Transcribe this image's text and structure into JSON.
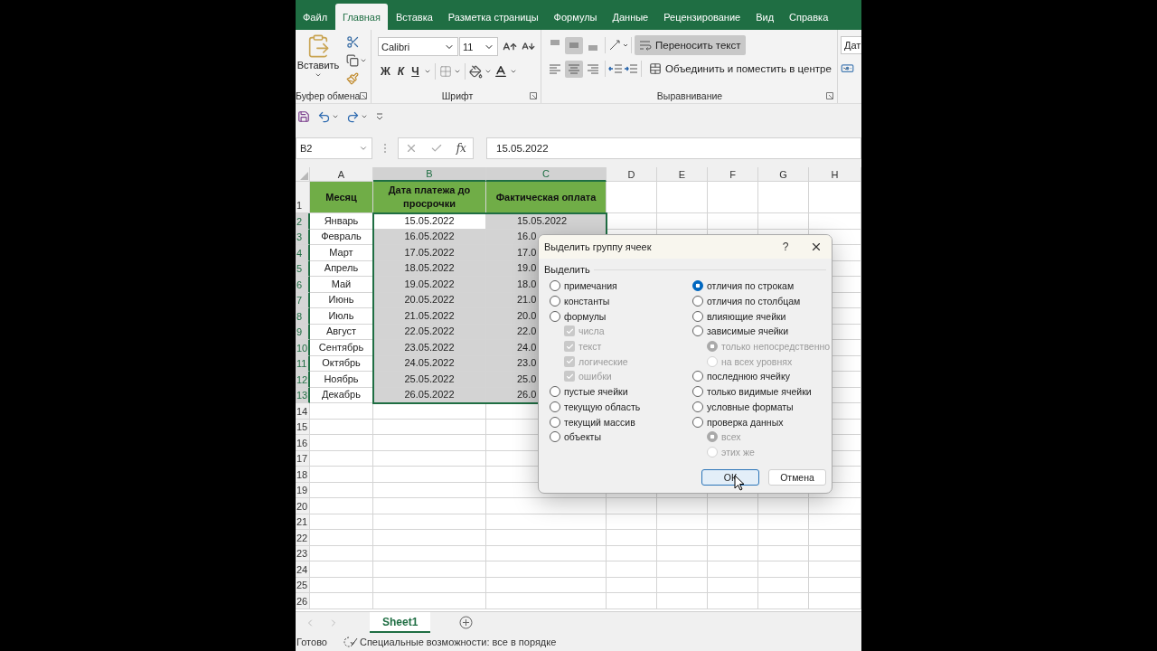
{
  "ribbon_tabs": [
    {
      "label": "Файл",
      "selected": false
    },
    {
      "label": "Главная",
      "selected": true
    },
    {
      "label": "Вставка",
      "selected": false
    },
    {
      "label": "Разметка страницы",
      "selected": false
    },
    {
      "label": "Формулы",
      "selected": false
    },
    {
      "label": "Данные",
      "selected": false
    },
    {
      "label": "Рецензирование",
      "selected": false
    },
    {
      "label": "Вид",
      "selected": false
    },
    {
      "label": "Справка",
      "selected": false
    }
  ],
  "ribbon": {
    "clipboard": {
      "paste": "Вставить",
      "label": "Буфер обмена"
    },
    "font": {
      "name": "Calibri",
      "size": "11",
      "bold": "Ж",
      "italic": "К",
      "underline": "Ч",
      "label": "Шрифт"
    },
    "alignment": {
      "vertical_align": [
        {
          "on": false
        },
        {
          "on": true
        },
        {
          "on": false
        }
      ],
      "horizontal_align": [
        {
          "on": false
        },
        {
          "on": true
        },
        {
          "on": false
        }
      ],
      "wrap_text": {
        "label": "Переносить текст",
        "on": true
      },
      "merge": {
        "label": "Объединить и поместить в центре"
      },
      "label": "Выравнивание"
    },
    "number_format": {
      "value": "Дат"
    }
  },
  "formula_bar": {
    "name_box": "B2",
    "function_label": "fx",
    "value": "15.05.2022"
  },
  "sheet": {
    "columns": [
      {
        "label": "A",
        "selected": false
      },
      {
        "label": "B",
        "selected": true
      },
      {
        "label": "C",
        "selected": true
      },
      {
        "label": "D",
        "selected": false
      },
      {
        "label": "E",
        "selected": false
      },
      {
        "label": "F",
        "selected": false
      },
      {
        "label": "G",
        "selected": false
      },
      {
        "label": "H",
        "selected": false
      }
    ],
    "header_row": {
      "number": "1",
      "cells": [
        "Месяц",
        "Дата платежа до просрочки",
        "Фактическая оплата"
      ]
    },
    "rows": [
      {
        "number": "2",
        "selected": true,
        "active": true,
        "month": "Январь",
        "due": "15.05.2022",
        "paid": "15.05.2022"
      },
      {
        "number": "3",
        "selected": true,
        "active": false,
        "month": "Февраль",
        "due": "16.05.2022",
        "paid": "16.0"
      },
      {
        "number": "4",
        "selected": true,
        "active": false,
        "month": "Март",
        "due": "17.05.2022",
        "paid": "17.0"
      },
      {
        "number": "5",
        "selected": true,
        "active": false,
        "month": "Апрель",
        "due": "18.05.2022",
        "paid": "19.0"
      },
      {
        "number": "6",
        "selected": true,
        "active": false,
        "month": "Май",
        "due": "19.05.2022",
        "paid": "18.0"
      },
      {
        "number": "7",
        "selected": true,
        "active": false,
        "month": "Июнь",
        "due": "20.05.2022",
        "paid": "21.0"
      },
      {
        "number": "8",
        "selected": true,
        "active": false,
        "month": "Июль",
        "due": "21.05.2022",
        "paid": "20.0"
      },
      {
        "number": "9",
        "selected": true,
        "active": false,
        "month": "Август",
        "due": "22.05.2022",
        "paid": "22.0"
      },
      {
        "number": "10",
        "selected": true,
        "active": false,
        "month": "Сентябрь",
        "due": "23.05.2022",
        "paid": "24.0"
      },
      {
        "number": "11",
        "selected": true,
        "active": false,
        "month": "Октябрь",
        "due": "24.05.2022",
        "paid": "23.0"
      },
      {
        "number": "12",
        "selected": true,
        "active": false,
        "month": "Ноябрь",
        "due": "25.05.2022",
        "paid": "25.0"
      },
      {
        "number": "13",
        "selected": true,
        "active": false,
        "month": "Декабрь",
        "due": "26.05.2022",
        "paid": "26.0"
      }
    ],
    "empty_rows": [
      "14",
      "15",
      "16",
      "17",
      "18",
      "19",
      "20",
      "21",
      "22",
      "23",
      "24",
      "25",
      "26"
    ]
  },
  "sheet_tabs": [
    {
      "label": "Sheet1",
      "selected": true
    }
  ],
  "status_bar": {
    "mode": "Готово",
    "accessibility": "Специальные возможности: все в порядке"
  },
  "dialog": {
    "title": "Выделить группу ячеек",
    "help": "?",
    "group_label": "Выделить",
    "left": [
      {
        "kind": "radio",
        "label": "примечания",
        "selected": false,
        "disabled": false
      },
      {
        "kind": "radio",
        "label": "константы",
        "selected": false,
        "disabled": false
      },
      {
        "kind": "radio",
        "label": "формулы",
        "selected": false,
        "disabled": false,
        "children": [
          {
            "kind": "checkbox",
            "label": "числа",
            "checked": true,
            "disabled": true
          },
          {
            "kind": "checkbox",
            "label": "текст",
            "checked": true,
            "disabled": true
          },
          {
            "kind": "checkbox",
            "label": "логические",
            "checked": true,
            "disabled": true
          },
          {
            "kind": "checkbox",
            "label": "ошибки",
            "checked": true,
            "disabled": true
          }
        ]
      },
      {
        "kind": "radio",
        "label": "пустые ячейки",
        "selected": false,
        "disabled": false
      },
      {
        "kind": "radio",
        "label": "текущую область",
        "selected": false,
        "disabled": false
      },
      {
        "kind": "radio",
        "label": "текущий массив",
        "selected": false,
        "disabled": false
      },
      {
        "kind": "radio",
        "label": "объекты",
        "selected": false,
        "disabled": false
      }
    ],
    "right": [
      {
        "kind": "radio",
        "label": "отличия по строкам",
        "selected": true,
        "disabled": false
      },
      {
        "kind": "radio",
        "label": "отличия по столбцам",
        "selected": false,
        "disabled": false
      },
      {
        "kind": "radio",
        "label": "влияющие ячейки",
        "selected": false,
        "disabled": false
      },
      {
        "kind": "radio",
        "label": "зависимые ячейки",
        "selected": false,
        "disabled": false,
        "children": [
          {
            "kind": "radio",
            "label": "только непосредственно",
            "selected": true,
            "disabled": true
          },
          {
            "kind": "radio",
            "label": "на всех уровнях",
            "selected": false,
            "disabled": true
          }
        ]
      },
      {
        "kind": "radio",
        "label": "последнюю ячейку",
        "selected": false,
        "disabled": false
      },
      {
        "kind": "radio",
        "label": "только видимые ячейки",
        "selected": false,
        "disabled": false
      },
      {
        "kind": "radio",
        "label": "условные форматы",
        "selected": false,
        "disabled": false
      },
      {
        "kind": "radio",
        "label": "проверка данных",
        "selected": false,
        "disabled": false,
        "children": [
          {
            "kind": "radio",
            "label": "всех",
            "selected": true,
            "disabled": true
          },
          {
            "kind": "radio",
            "label": "этих же",
            "selected": false,
            "disabled": true
          }
        ]
      }
    ],
    "buttons": [
      {
        "label": "ОК",
        "default": true
      },
      {
        "label": "Отмена",
        "default": false
      }
    ]
  }
}
